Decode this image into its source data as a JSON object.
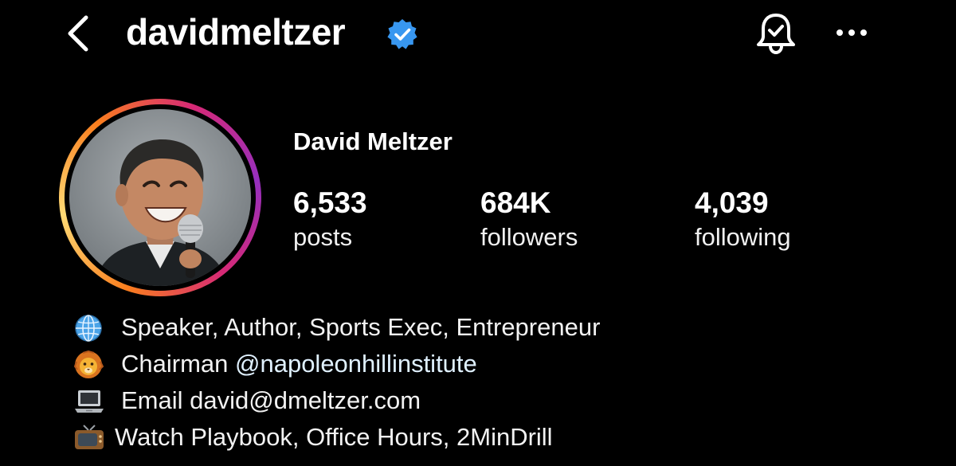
{
  "header": {
    "username": "davidmeltzer",
    "verified": true,
    "back_icon": "chevron-left-icon",
    "notify_icon": "bell-check-icon",
    "more_icon": "more-horizontal-icon"
  },
  "profile": {
    "display_name": "David Meltzer",
    "avatar": "profile-photo",
    "story_ring": true
  },
  "stats": [
    {
      "value": "6,533",
      "label": "posts"
    },
    {
      "value": "684K",
      "label": "followers"
    },
    {
      "value": "4,039",
      "label": "following"
    }
  ],
  "bio": {
    "line1": {
      "emoji": "globe-emoji",
      "text": "Speaker, Author, Sports Exec, Entrepreneur"
    },
    "line2": {
      "emoji": "lion-emoji",
      "prefix": "Chairman ",
      "mention": "@napoleonhillinstitute"
    },
    "line3": {
      "emoji": "laptop-emoji",
      "prefix": "Email ",
      "email": "david@dmeltzer.com"
    },
    "line4": {
      "emoji": "tv-emoji",
      "text": "Watch Playbook, Office Hours, 2MinDrill"
    }
  },
  "colors": {
    "background": "#000000",
    "text": "#ffffff",
    "verified_badge": "#3897f0",
    "mention": "#e0f1ff"
  }
}
